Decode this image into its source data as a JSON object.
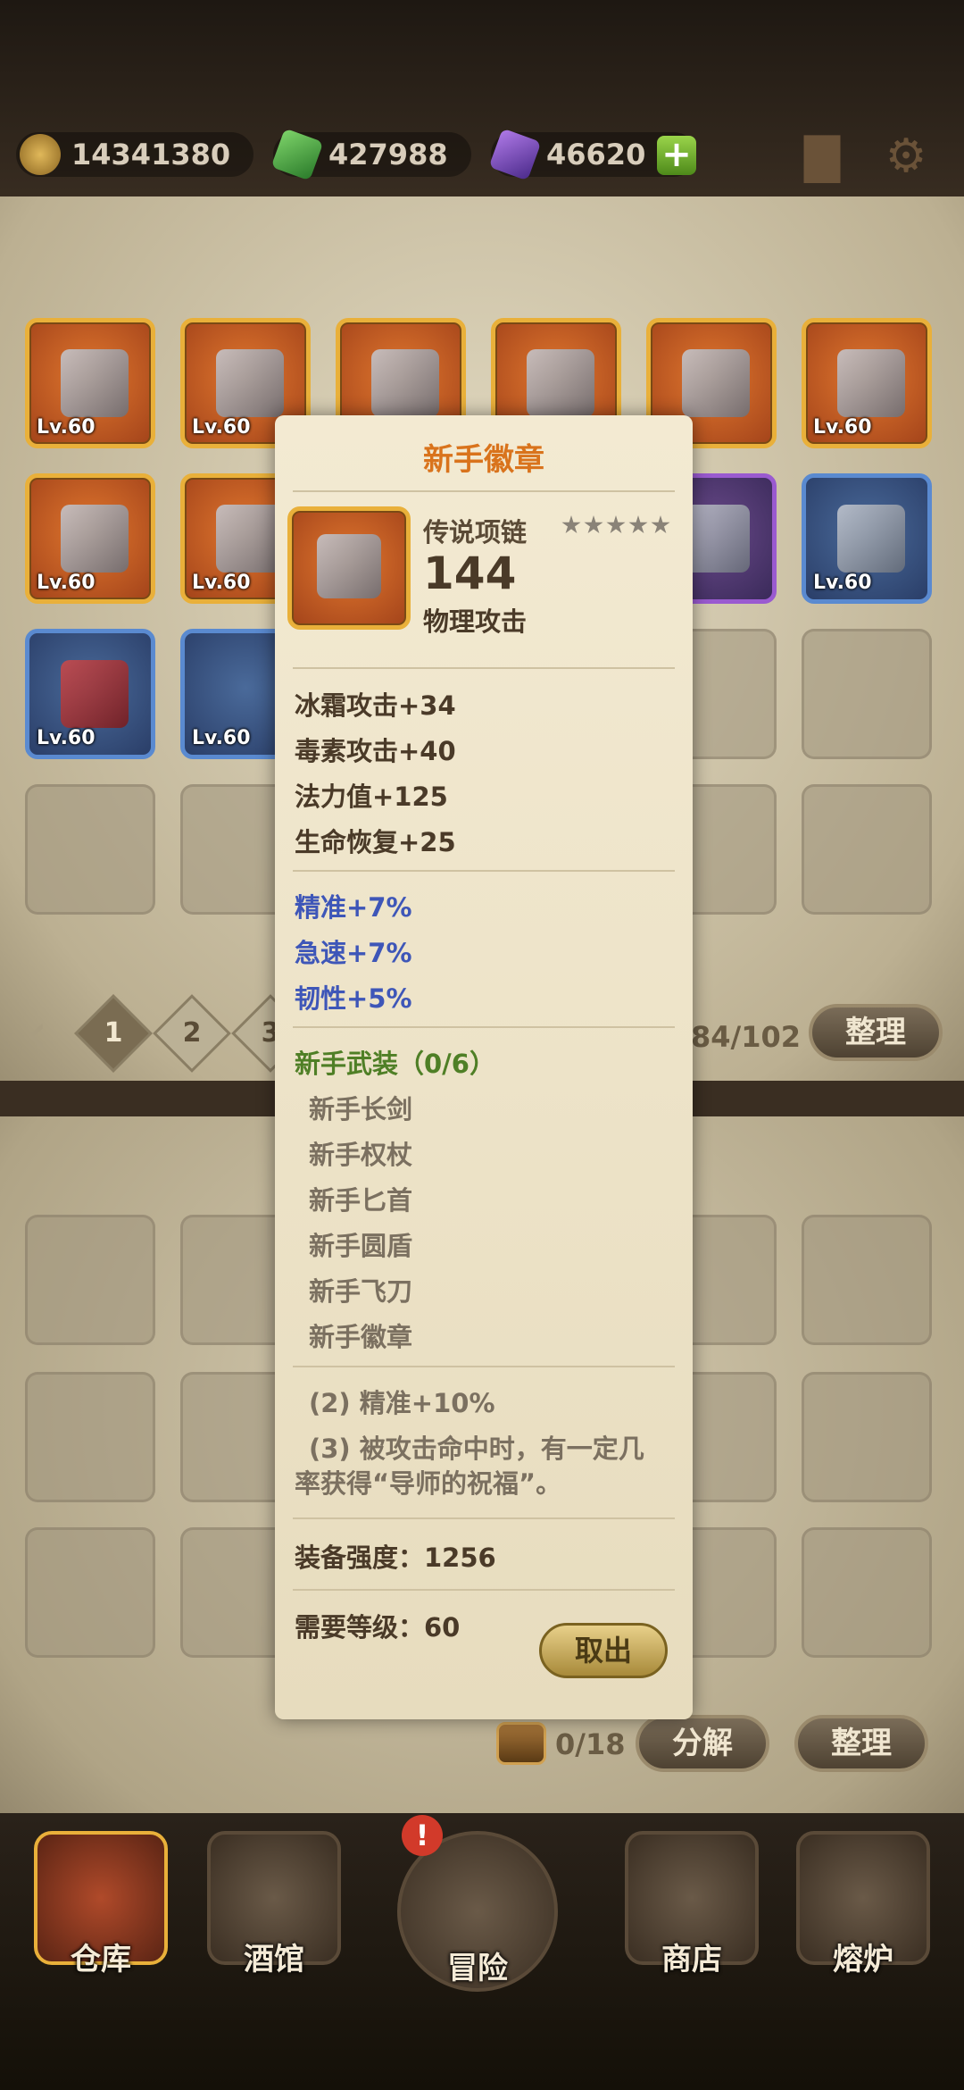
{
  "resources": {
    "gold": "14341380",
    "green_gem": "427988",
    "purple_gem": "46620"
  },
  "inventory": {
    "level_label": "Lv.60",
    "pagination": [
      "1",
      "2",
      "3"
    ],
    "capacity": "84/102",
    "sort_label": "整理"
  },
  "storage": {
    "capacity": "0/18",
    "decompose_label": "分解",
    "sort_label": "整理"
  },
  "nav": [
    {
      "label": "仓库",
      "icon": "warehouse-icon"
    },
    {
      "label": "酒馆",
      "icon": "tavern-icon"
    },
    {
      "label": "冒险",
      "icon": "adventure-icon"
    },
    {
      "label": "商店",
      "icon": "shop-icon"
    },
    {
      "label": "熔炉",
      "icon": "furnace-icon"
    }
  ],
  "popup": {
    "title": "新手徽章",
    "type": "传说项链",
    "value": "144",
    "value_type": "物理攻击",
    "base_stats": [
      "冰霜攻击+34",
      "毒素攻击+40",
      "法力值+125",
      "生命恢复+25"
    ],
    "bonus_stats": [
      "精准+7%",
      "急速+7%",
      "韧性+5%"
    ],
    "set_name": "新手武装（0/6）",
    "set_items": [
      "新手长剑",
      "新手权杖",
      "新手匕首",
      "新手圆盾",
      "新手飞刀",
      "新手徽章"
    ],
    "set_bonus_2": "(2) 精准+10%",
    "set_bonus_3_line1": "(3) 被攻击命中时，有一定几",
    "set_bonus_3_line2": "率获得“导师的祝福”。",
    "power": "装备强度：1256",
    "required_level": "需要等级：60",
    "withdraw_label": "取出"
  },
  "colors": {
    "title_orange": "#d9731c",
    "bonus_blue": "#3e56b8",
    "set_green": "#4f7f26"
  }
}
